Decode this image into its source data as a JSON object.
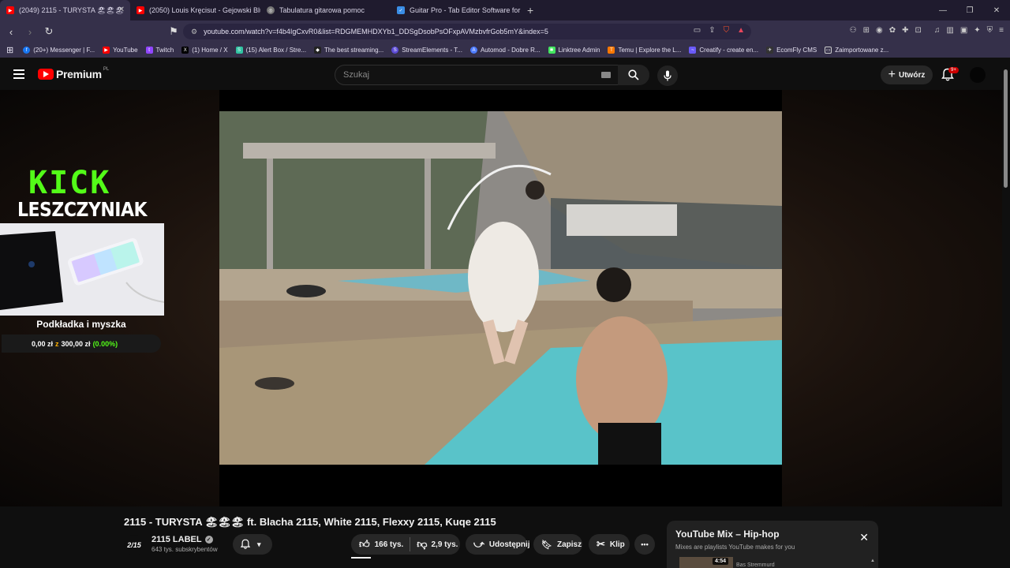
{
  "tabs": [
    {
      "title": "(2049) 2115 - TURYSTA 🏖🏖🏖",
      "color": "#ff0000",
      "active": true
    },
    {
      "title": "(2050) Louis Kręcisut - Gejowski Blue",
      "color": "#ff0000",
      "active": false
    },
    {
      "title": "Tabulatura gitarowa pomoc",
      "color": "#cccccc",
      "active": false
    },
    {
      "title": "Guitar Pro - Tab Editor Software for G",
      "color": "#3a8ee6",
      "active": false
    }
  ],
  "browser": {
    "url": "youtube.com/watch?v=f4b4IgCxvR0&list=RDGMEMHDXYb1_DDSgDsobPsOFxpAVMzbvfrGob5mY&index=5"
  },
  "bookmarks": [
    {
      "label": "(20+) Messenger | F...",
      "color": "#1877f2",
      "icon": "f"
    },
    {
      "label": "YouTube",
      "color": "#ff0000",
      "icon": "▶"
    },
    {
      "label": "Twitch",
      "color": "#9146ff",
      "icon": "t"
    },
    {
      "label": "(1) Home / X",
      "color": "#000000",
      "icon": "X"
    },
    {
      "label": "(15) Alert Box / Stre...",
      "color": "#31c3a2",
      "icon": "S"
    },
    {
      "label": "The best streaming...",
      "color": "#222222",
      "icon": "◆"
    },
    {
      "label": "StreamElements - T...",
      "color": "#5c4bd6",
      "icon": "S"
    },
    {
      "label": "Automod - Dobre R...",
      "color": "#4d7cff",
      "icon": "A"
    },
    {
      "label": "Linktree Admin",
      "color": "#43e660",
      "icon": "✱"
    },
    {
      "label": "Temu | Explore the L...",
      "color": "#fb7701",
      "icon": "T"
    },
    {
      "label": "Creatify - create en...",
      "color": "#6a5af9",
      "icon": "~"
    },
    {
      "label": "EcomFly CMS",
      "color": "#333333",
      "icon": "✈"
    },
    {
      "label": "Zaimportowane z...",
      "color": "#35304a",
      "icon": "▭"
    }
  ],
  "yt": {
    "logo_word": "Premium",
    "logo_region": "PL",
    "search_placeholder": "Szukaj",
    "create_label": "Utwórz",
    "notif_badge": "9+"
  },
  "overlay": {
    "kick": "KICK",
    "name": "LESZCZYNIAK",
    "goal_title": "Podkładka i myszka",
    "goal_current": "0,00 zł",
    "goal_sep": "z",
    "goal_target": "300,00 zł",
    "goal_pct": "(0.00%)"
  },
  "video": {
    "title": "2115 - TURYSTA 🏖🏖🏖 ft. Blacha 2115, White 2115, Flexxy 2115, Kuqe 2115",
    "channel": "2115 LABEL",
    "channel_logo": "2/15",
    "subscribers": "643 tys. subskrybentów",
    "likes": "166 tys.",
    "dislikes": "2,9 tys.",
    "share": "Udostępnij",
    "save": "Zapisz",
    "clip": "Klip",
    "more": "•••"
  },
  "mix": {
    "title": "YouTube Mix – Hip-hop",
    "subtitle": "Mixes are playlists YouTube makes for you",
    "first_duration": "4:54",
    "first_artist": "Bas Stremmurd"
  }
}
